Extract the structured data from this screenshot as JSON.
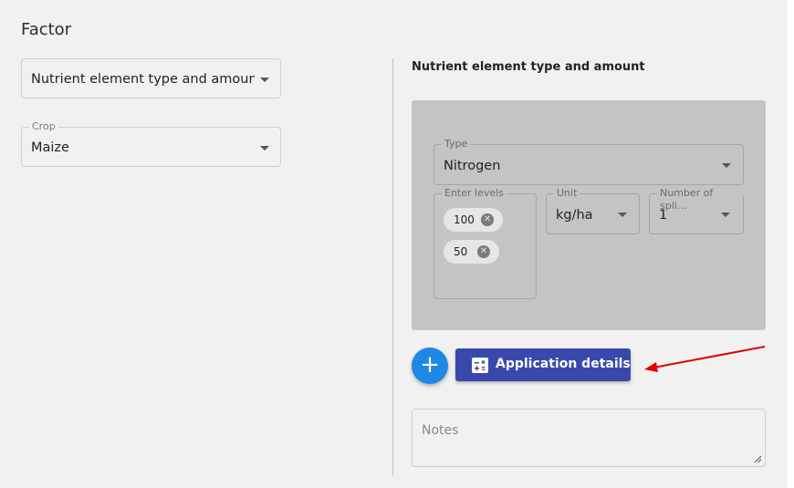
{
  "page": {
    "title": "Factor"
  },
  "factor_select": {
    "value": "Nutrient element type and amoun"
  },
  "crop_select": {
    "label": "Crop",
    "value": "Maize"
  },
  "detail": {
    "heading": "Nutrient element type and amount",
    "type": {
      "label": "Type",
      "value": "Nitrogen"
    },
    "levels": {
      "label": "Enter levels",
      "chips": [
        "100",
        "50"
      ]
    },
    "unit": {
      "label": "Unit",
      "value": "kg/ha"
    },
    "splits": {
      "label": "Number of spli...",
      "value": "1"
    }
  },
  "actions": {
    "add_icon": "plus-icon",
    "app_details_label": "Application details",
    "app_details_icon": "calculator-icon"
  },
  "notes": {
    "placeholder": "Notes"
  },
  "colors": {
    "accent": "#3949ab",
    "fab": "#1e88e5",
    "arrow": "#e00000"
  }
}
